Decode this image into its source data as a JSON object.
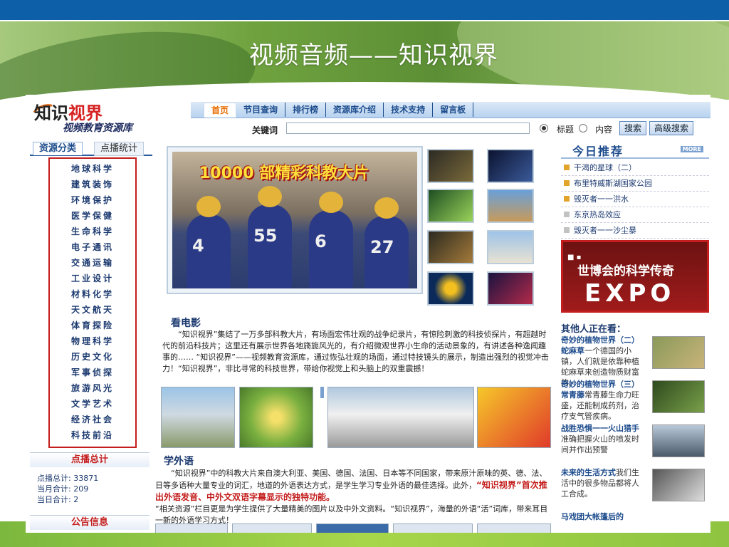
{
  "slide": {
    "title": "视频音频——知识视界"
  },
  "site": {
    "logo": {
      "part1": "知识",
      "part2": "视界",
      "subtitle": "视频教育资源库"
    },
    "nav": [
      "首页",
      "节目查询",
      "排行榜",
      "资源库介绍",
      "技术支持",
      "留言板"
    ],
    "search": {
      "keyword_label": "关键词",
      "value": "",
      "opt_title": "标题",
      "opt_content": "内容",
      "search_btn": "搜索",
      "adv_btn": "高级搜索"
    },
    "tabs": [
      "资源分类",
      "点播统计"
    ],
    "categories": [
      "地球科学",
      "建筑装饰",
      "环境保护",
      "医学保健",
      "生命科学",
      "电子通讯",
      "交通运输",
      "工业设计",
      "材料化学",
      "天文航天",
      "体育探险",
      "物理科学",
      "历史文化",
      "军事侦探",
      "旅游风光",
      "文学艺术",
      "经济社会",
      "科技前沿"
    ],
    "stats_title": "点播总计",
    "stats": {
      "total": "点播总计: 33871",
      "month": "当月合计: 209",
      "day": "当日合计: 2"
    },
    "notice_title": "公告信息",
    "hero_title": "10000 部精彩科教大片",
    "jerseys": [
      "4",
      "55",
      "6",
      "27"
    ],
    "recommend_title": "今日推荐",
    "more": "MORE",
    "recommend": [
      "干渴的星球（二）",
      "布里特威斯湖国家公园",
      "毁灭者一一洪水",
      "东京热岛效应",
      "毁灭者一一沙尘暴"
    ],
    "expo": {
      "line1": "世博会的科学传奇",
      "line2": "EXPO"
    },
    "watching_title": "其他人正在看：",
    "watching": [
      {
        "head": "奇妙的植物世界（二）蛇麻草",
        "body": "一个德国的小镇，人们就是依靠种植蛇麻草来创造物质财富的。"
      },
      {
        "head": "奇妙的植物世界（三）常青藤",
        "body": "常青藤生命力旺盛，还能制成药剂，治疗支气管疾病。"
      },
      {
        "head": "战胜恐惧一一火山猎手",
        "body": "准确把握火山的喷发时间并作出预警"
      },
      {
        "head": "未来的生活方式",
        "body": "我们生活中的很多物品都将人工合成。"
      },
      {
        "head": "马戏团大帐篷后的",
        "body": ""
      }
    ],
    "movie_title": "看电影",
    "movie_text": "“知识视界”集结了一万多部科教大片，有场面宏伟壮观的战争纪录片，有惊险刺激的科技侦探片，有超越时代的前沿科技片；这里还有展示世界各地旖旎风光的，有介绍微观世界小生命的活动景象的，有讲述各种逸闻趣事的…… “知识视界”——视频教育资源库，通过恢弘壮观的场面，通过特技镜头的展示，制造出强烈的视觉冲击力！“知识视界”，非比寻常的科技世界，带给你视觉上和头脑上的双重震撼！",
    "foreign_title": "学外语",
    "foreign_text1": "“知识视界”中的科教大片来自澳大利亚、美国、德国、法国、日本等不同国家，带来原汁原味的英、德、法、日等多语种大量专业的词汇，地道的外语表达方式，是学生学习专业外语的最佳选择。此外，",
    "foreign_highlight": "“知识视界”首次推出外语发音、中外文双语字幕显示的独特功能。",
    "foreign_text2": "“相关资源”栏目更是为学生提供了大量精美的图片以及中外文资料。“知识视界”，海量的外语“活”词库，带来耳目一新的外语学习方式！"
  },
  "colors": {
    "nav_blue": "#1c4b8c",
    "accent_red": "#c41d1d",
    "topbar": "#0d5fa8"
  }
}
